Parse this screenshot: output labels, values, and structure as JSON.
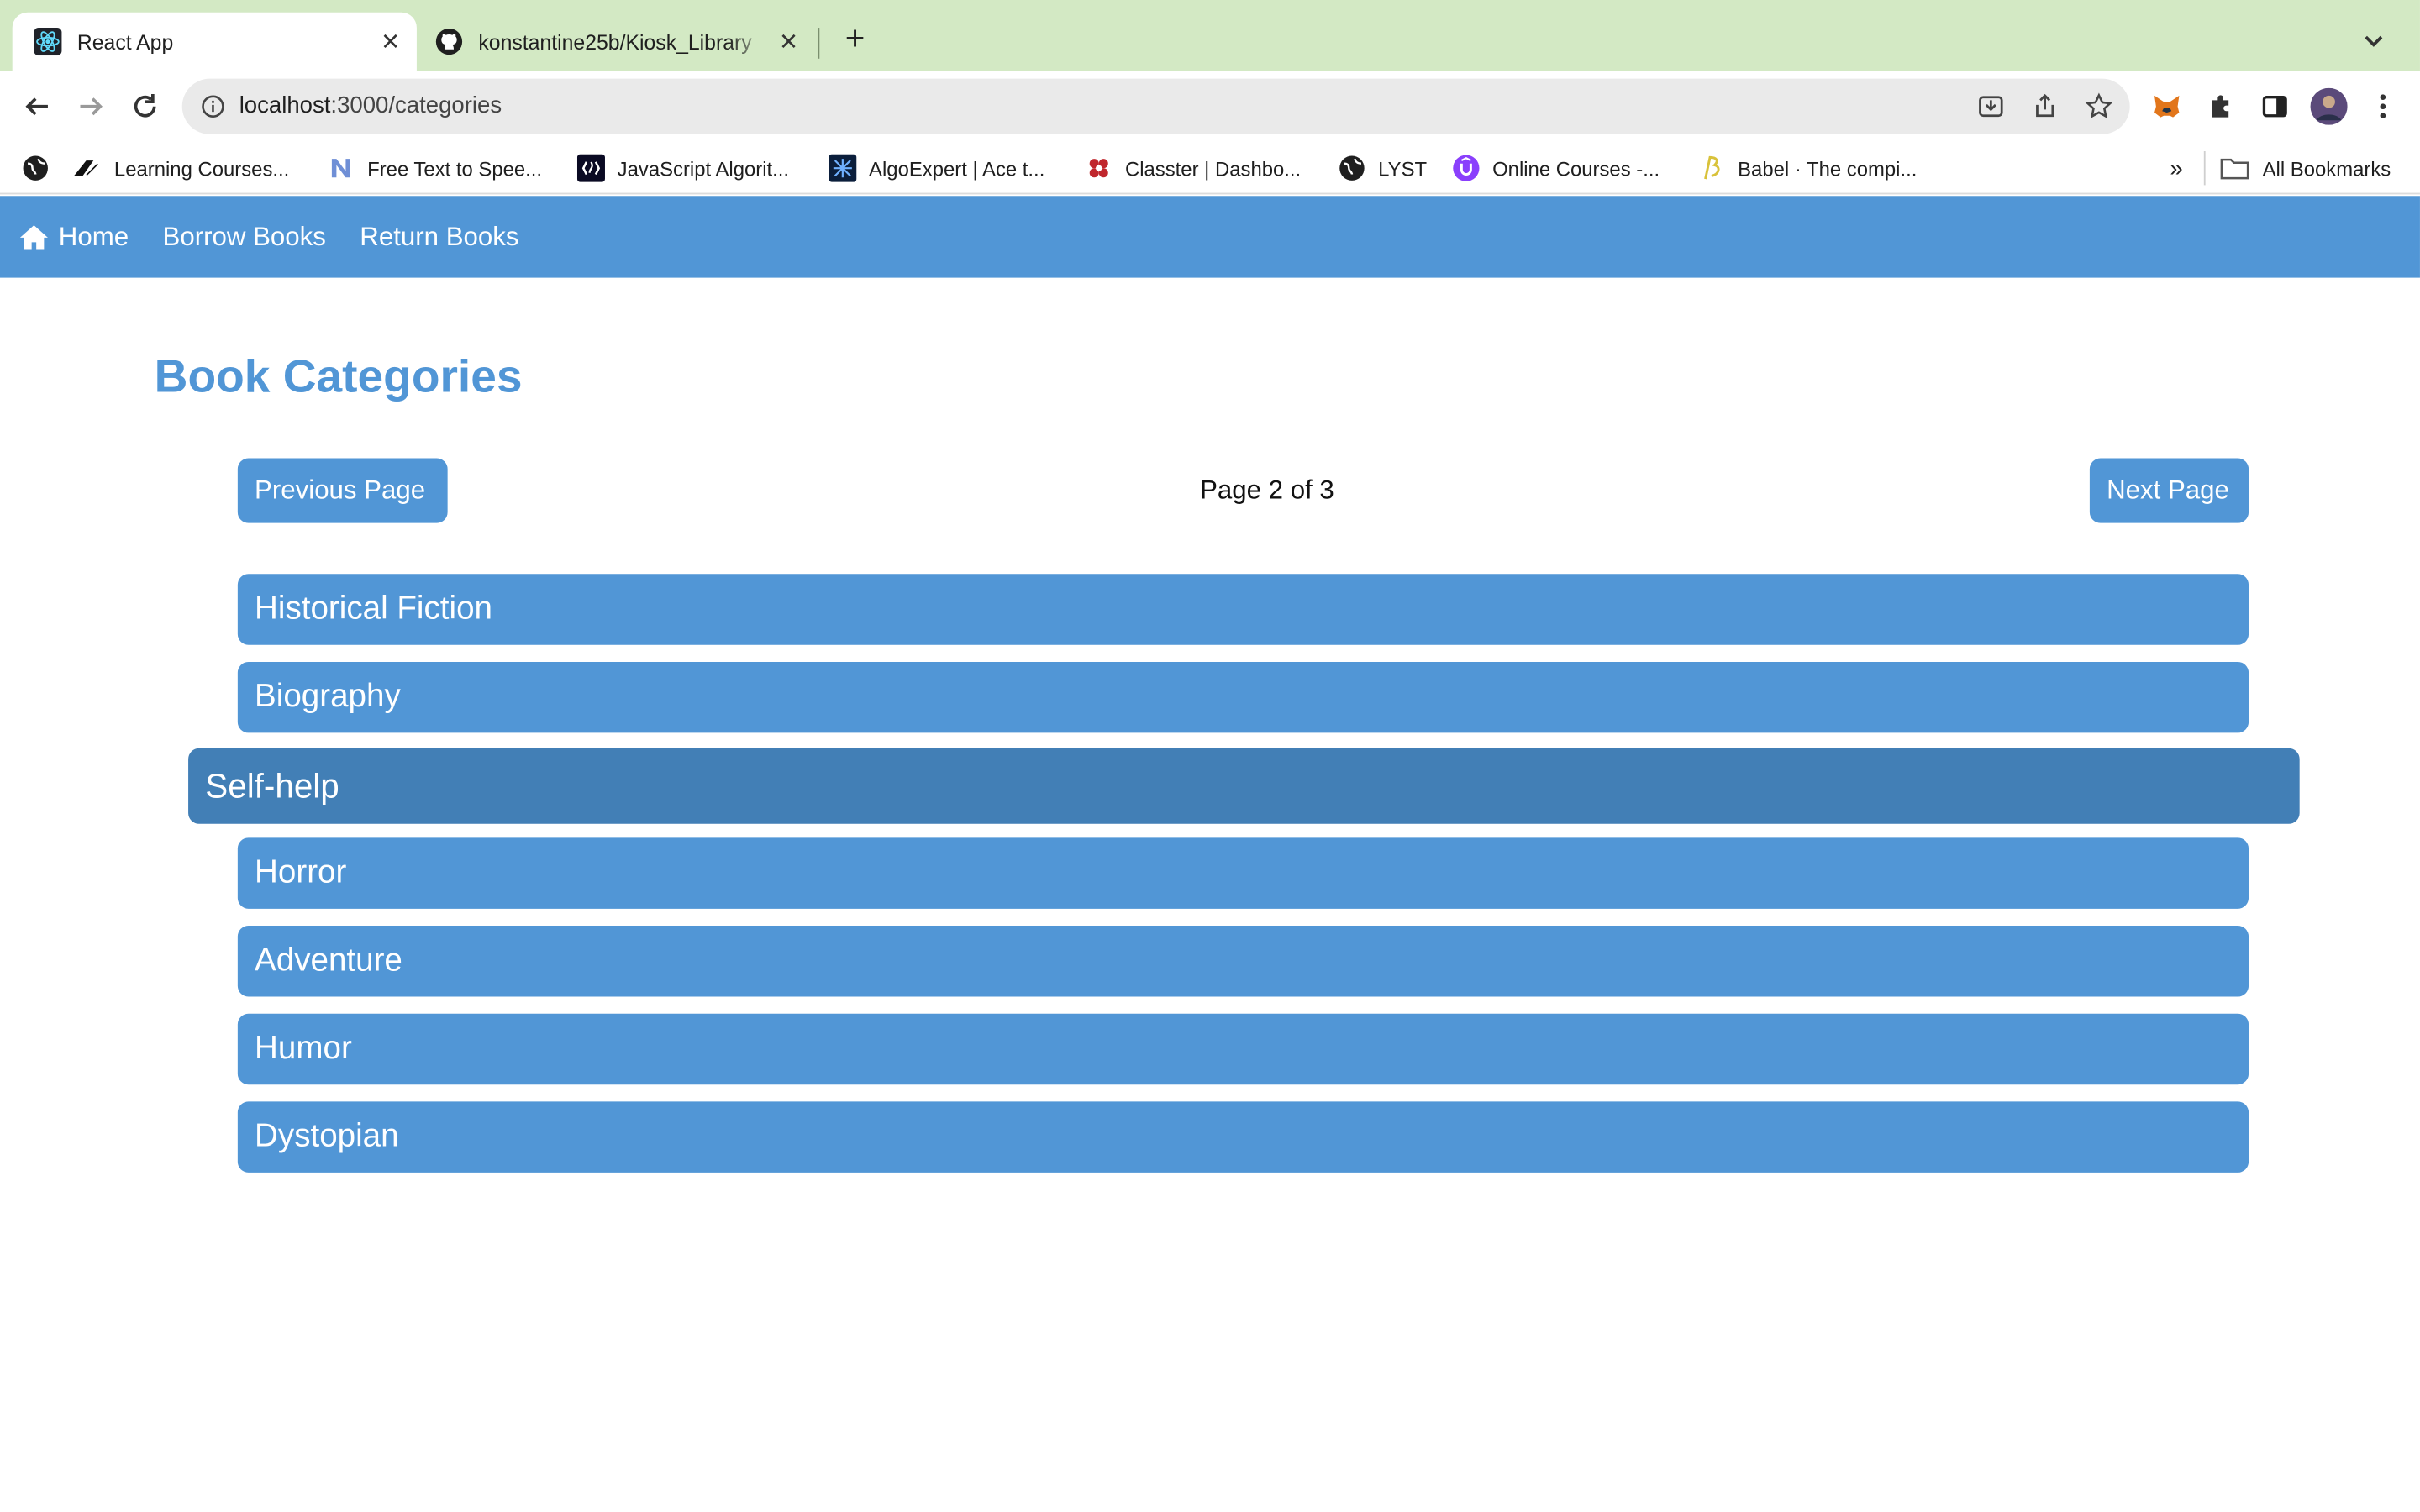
{
  "browser": {
    "tabs": [
      {
        "title": "React App",
        "active": true,
        "icon": "react-icon"
      },
      {
        "title": "konstantine25b/Kiosk_Library",
        "active": false,
        "icon": "github-icon"
      }
    ],
    "url_host": "localhost",
    "url_path": ":3000/categories",
    "bookmarks": [
      {
        "label": "",
        "icon": "globe-icon"
      },
      {
        "label": "Learning Courses...",
        "icon": "coursera-logo-icon"
      },
      {
        "label": "Free Text to Spee...",
        "icon": "n-logo-icon"
      },
      {
        "label": "JavaScript Algorit...",
        "icon": "freecodecamp-icon"
      },
      {
        "label": "AlgoExpert | Ace t...",
        "icon": "algoexpert-icon"
      },
      {
        "label": "Classter | Dashbo...",
        "icon": "classter-icon"
      },
      {
        "label": "LYST",
        "icon": "globe-icon"
      },
      {
        "label": "Online Courses -...",
        "icon": "udemy-icon"
      },
      {
        "label": "Babel · The compi...",
        "icon": "babel-icon"
      }
    ],
    "bookmarks_overflow": "»",
    "all_bookmarks": "All Bookmarks"
  },
  "nav": {
    "home": "Home",
    "borrow": "Borrow Books",
    "return": "Return Books"
  },
  "page": {
    "title": "Book Categories",
    "prev": "Previous Page",
    "next": "Next Page",
    "indicator": "Page 2 of 3"
  },
  "categories": [
    "Historical Fiction",
    "Biography",
    "Self-help",
    "Horror",
    "Adventure",
    "Humor",
    "Dystopian"
  ],
  "colors": {
    "accent": "#5196d6",
    "accent_hover": "#427fb6",
    "tabbar": "#d3e9c4"
  }
}
